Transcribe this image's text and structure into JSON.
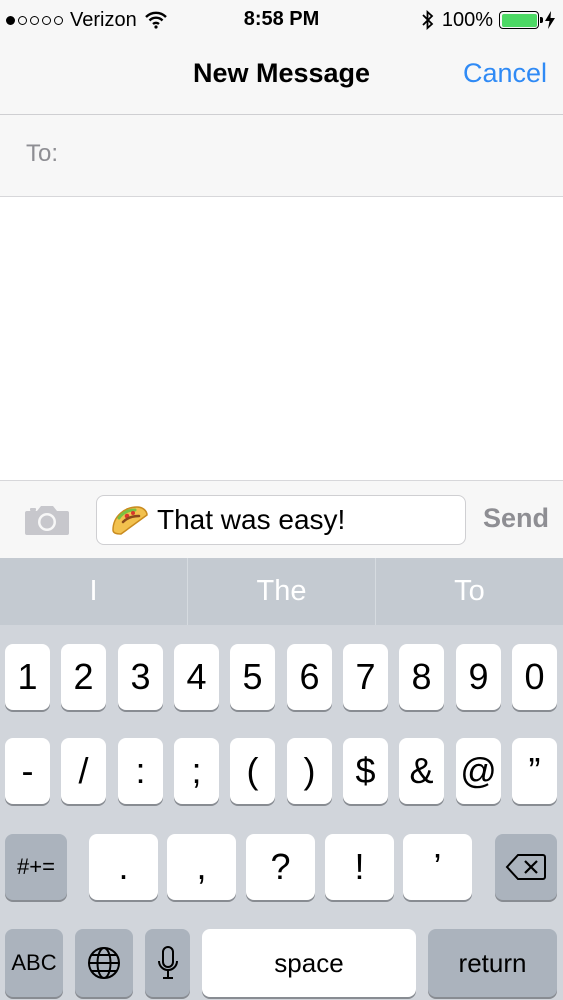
{
  "status_bar": {
    "carrier": "Verizon",
    "time": "8:58 PM",
    "battery_percent": "100%",
    "battery_level": 1.0,
    "signal_bars_filled": 1,
    "icons": [
      "wifi-icon",
      "bluetooth-icon",
      "battery-icon",
      "charging-bolt-icon"
    ]
  },
  "nav": {
    "title": "New Message",
    "cancel": "Cancel",
    "accent_color": "#2f8af5"
  },
  "to_field": {
    "label": "To:"
  },
  "compose": {
    "emoji_icon": "taco-emoji-icon",
    "text": "That was easy!",
    "send": "Send",
    "camera_icon": "camera-icon"
  },
  "predictive": [
    "I",
    "The",
    "To"
  ],
  "keyboard": {
    "row1": [
      "1",
      "2",
      "3",
      "4",
      "5",
      "6",
      "7",
      "8",
      "9",
      "0"
    ],
    "row2": [
      "-",
      "/",
      ":",
      ";",
      "(",
      ")",
      "$",
      "&",
      "@",
      "”"
    ],
    "row3_switch": "#+=",
    "row3": [
      ".",
      ",",
      "?",
      "!",
      "’"
    ],
    "delete_icon": "backspace-icon",
    "abc": "ABC",
    "globe_icon": "globe-icon",
    "mic_icon": "microphone-icon",
    "space": "space",
    "return": "return"
  }
}
